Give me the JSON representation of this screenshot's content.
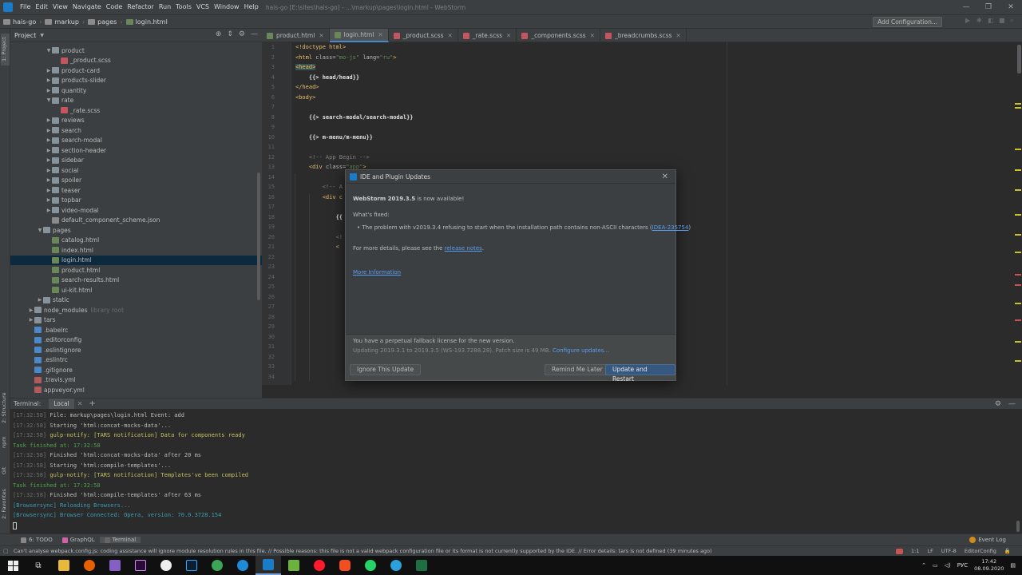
{
  "window": {
    "title": "hais-go [E:\\sites\\hais-go] - ...\\markup\\pages\\login.html - WebStorm"
  },
  "menu": [
    "File",
    "Edit",
    "View",
    "Navigate",
    "Code",
    "Refactor",
    "Run",
    "Tools",
    "VCS",
    "Window",
    "Help"
  ],
  "breadcrumbs": [
    "hais-go",
    "markup",
    "pages",
    "login.html"
  ],
  "toolbar": {
    "add_config": "Add Configuration..."
  },
  "project_panel": {
    "title": "Project",
    "items": [
      {
        "label": "product",
        "type": "folder",
        "open": true,
        "depth": 2
      },
      {
        "label": "_product.scss",
        "type": "scss",
        "depth": 3
      },
      {
        "label": "product-card",
        "type": "folder",
        "open": false,
        "depth": 2
      },
      {
        "label": "products-slider",
        "type": "folder",
        "open": false,
        "depth": 2
      },
      {
        "label": "quantity",
        "type": "folder",
        "open": false,
        "depth": 2
      },
      {
        "label": "rate",
        "type": "folder",
        "open": true,
        "depth": 2
      },
      {
        "label": "_rate.scss",
        "type": "scss",
        "depth": 3
      },
      {
        "label": "reviews",
        "type": "folder",
        "open": false,
        "depth": 2
      },
      {
        "label": "search",
        "type": "folder",
        "open": false,
        "depth": 2
      },
      {
        "label": "search-modal",
        "type": "folder",
        "open": false,
        "depth": 2
      },
      {
        "label": "section-header",
        "type": "folder",
        "open": false,
        "depth": 2
      },
      {
        "label": "sidebar",
        "type": "folder",
        "open": false,
        "depth": 2
      },
      {
        "label": "social",
        "type": "folder",
        "open": false,
        "depth": 2
      },
      {
        "label": "spoiler",
        "type": "folder",
        "open": false,
        "depth": 2
      },
      {
        "label": "teaser",
        "type": "folder",
        "open": false,
        "depth": 2
      },
      {
        "label": "topbar",
        "type": "folder",
        "open": false,
        "depth": 2
      },
      {
        "label": "video-modal",
        "type": "folder",
        "open": false,
        "depth": 2
      },
      {
        "label": "default_component_scheme.json",
        "type": "json",
        "depth": 2
      },
      {
        "label": "pages",
        "type": "folder",
        "open": true,
        "depth": 1
      },
      {
        "label": "catalog.html",
        "type": "html",
        "depth": 2
      },
      {
        "label": "index.html",
        "type": "html",
        "depth": 2
      },
      {
        "label": "login.html",
        "type": "html",
        "depth": 2,
        "selected": true
      },
      {
        "label": "product.html",
        "type": "html",
        "depth": 2
      },
      {
        "label": "search-results.html",
        "type": "html",
        "depth": 2
      },
      {
        "label": "ui-kit.html",
        "type": "html",
        "depth": 2
      },
      {
        "label": "static",
        "type": "folder",
        "open": false,
        "depth": 1
      },
      {
        "label": "node_modules",
        "type": "folder",
        "open": false,
        "depth": 0,
        "hint": "library root"
      },
      {
        "label": "tars",
        "type": "folder",
        "open": false,
        "depth": 0
      },
      {
        "label": ".babelrc",
        "type": "config",
        "depth": 0
      },
      {
        "label": ".editorconfig",
        "type": "config",
        "depth": 0
      },
      {
        "label": ".eslintignore",
        "type": "config",
        "depth": 0
      },
      {
        "label": ".eslintrc",
        "type": "config",
        "depth": 0
      },
      {
        "label": ".gitignore",
        "type": "config",
        "depth": 0
      },
      {
        "label": ".travis.yml",
        "type": "yml",
        "depth": 0
      },
      {
        "label": "appveyor.yml",
        "type": "yml",
        "depth": 0
      }
    ]
  },
  "editor_tabs": [
    {
      "label": "product.html",
      "type": "html"
    },
    {
      "label": "login.html",
      "type": "html",
      "active": true
    },
    {
      "label": "_product.scss",
      "type": "scss"
    },
    {
      "label": "_rate.scss",
      "type": "scss"
    },
    {
      "label": "_components.scss",
      "type": "scss"
    },
    {
      "label": "_breadcrumbs.scss",
      "type": "scss"
    }
  ],
  "line_numbers": [
    "1",
    "2",
    "3",
    "4",
    "5",
    "6",
    "7",
    "8",
    "9",
    "10",
    "11",
    "12",
    "13",
    "14",
    "15",
    "16",
    "17",
    "18",
    "19",
    "20",
    "21",
    "22",
    "23",
    "24",
    "25",
    "26",
    "27",
    "28",
    "29",
    "30",
    "31",
    "32",
    "33",
    "34"
  ],
  "code": {
    "l1": "<!doctype html>",
    "l2a": "<html ",
    "l2b": "class=",
    "l2c": "\"mo-js\" ",
    "l2d": "lang=",
    "l2e": "\"ru\"",
    "l2f": ">",
    "l3": "<head>",
    "l4": "    {{> head/head}}",
    "l5": "</head>",
    "l6": "<body>",
    "l8": "    {{> search-modal/search-modal}}",
    "l10": "    {{> m-menu/m-menu}}",
    "l12": "    <!-- App Begin -->",
    "l13a": "    <div ",
    "l13b": "class=",
    "l13c": "\"app\"",
    "l13d": ">",
    "l15": "        <!-- A",
    "l16": "        <div c",
    "l18": "            {{",
    "l20": "            <!",
    "l21": "            <"
  },
  "dialog": {
    "title": "IDE and Plugin Updates",
    "headline_bold": "WebStorm 2019.3.5",
    "headline_rest": " is now available!",
    "whats_fixed": "What's fixed:",
    "bullet": "The problem with v2019.3.4 refusing to start when the installation path contains non-ASCII characters (",
    "bullet_link": "IDEA-235754",
    "bullet_end": ")",
    "details_pre": "For more details, please see the ",
    "details_link": "release notes",
    "details_end": ".",
    "more_info": "More Information",
    "license": "You have a perpetual fallback license for the new version.",
    "patch": "Updating 2019.3.1 to 2019.3.5 (WS-193.7288.28). Patch size is 49 MB.",
    "configure": "Configure updates...",
    "btn_ignore": "Ignore This Update",
    "btn_remind": "Remind Me Later",
    "btn_update": "Update and Restart"
  },
  "terminal": {
    "header": "Terminal:",
    "tab": "Local",
    "lines": [
      [
        "[17:32:58] ",
        "File: markup\\pages\\login.html Event: add"
      ],
      [
        "[17:32:58] ",
        "Starting 'html:concat-mocks-data'..."
      ],
      [
        "[17:32:58] ",
        "gulp-notify: [TARS notification] Data for components ready"
      ],
      [
        "",
        "Task finished at: 17:32:58"
      ],
      [
        "[17:32:58] ",
        "Finished 'html:concat-mocks-data' after 20 ms"
      ],
      [
        "[17:32:58] ",
        "Starting 'html:compile-templates'..."
      ],
      [
        "[17:32:58] ",
        "gulp-notify: [TARS notification] Templates've been compiled"
      ],
      [
        "",
        "Task finished at: 17:32:58"
      ],
      [
        "[17:32:58] ",
        "Finished 'html:compile-templates' after 63 ms"
      ],
      [
        "[Browsersync] ",
        "Reloading Browsers..."
      ],
      [
        "[Browsersync] ",
        "Browser Connected: Opera, version: 70.0.3728.154"
      ]
    ]
  },
  "bottom_tabs": {
    "todo": "6: TODO",
    "graphql": "GraphQL",
    "terminal": "Terminal",
    "event_log": "Event Log"
  },
  "left_tabs": {
    "project": "1: Project",
    "structure": "2: Structure",
    "npm": "npm",
    "favorites": "2: Favorites",
    "git": "Git"
  },
  "status": {
    "message": "Can't analyse webpack.config.js: coding assistance will ignore module resolution rules in this file. // Possible reasons: this file is not a valid webpack configuration file or its format is not currently supported by the IDE. // Error details: tars is not defined (39 minutes ago)",
    "position": "1:1",
    "line_sep": "LF",
    "encoding": "UTF-8",
    "editorconfig": "EditorConfig"
  },
  "taskbar": {
    "lang": "РУС",
    "time": "17:42",
    "date": "08.09.2020"
  },
  "colors": {
    "accent": "#4a88c7",
    "primary_button": "#365880",
    "selection": "#0d293e"
  }
}
